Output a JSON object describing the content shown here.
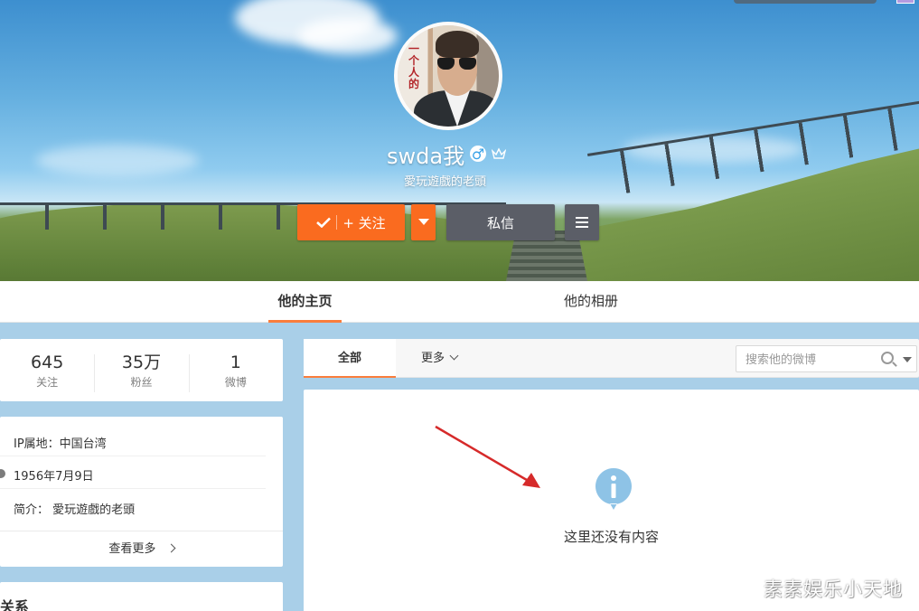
{
  "profile": {
    "username": "swda我",
    "bio_line": "愛玩遊戲的老頭",
    "gender_symbol": "♂",
    "avatar_sign_text": "一个人的"
  },
  "actions": {
    "follow_label": "+ 关注",
    "message_label": "私信"
  },
  "tabs": {
    "home": "他的主页",
    "album": "他的相册"
  },
  "stats": [
    {
      "num": "645",
      "label": "关注"
    },
    {
      "num": "35万",
      "label": "粉丝"
    },
    {
      "num": "1",
      "label": "微博"
    }
  ],
  "info": {
    "ip": "IP属地：中国台湾",
    "birthday": "1956年7月9日",
    "intro": "简介： 愛玩遊戲的老頭",
    "more": "查看更多"
  },
  "relations_title": "关系",
  "feed": {
    "tab_all": "全部",
    "tab_more": "更多",
    "search_placeholder": "搜索他的微博",
    "empty_text": "这里还没有内容"
  },
  "watermark": "素素娱乐小天地",
  "colors": {
    "accent": "#fa6b1f",
    "tab_underline": "#fa7d3c",
    "dark_button": "#5b5e67",
    "info_icon": "#8ec3e6",
    "arrow": "#d62a2a"
  }
}
